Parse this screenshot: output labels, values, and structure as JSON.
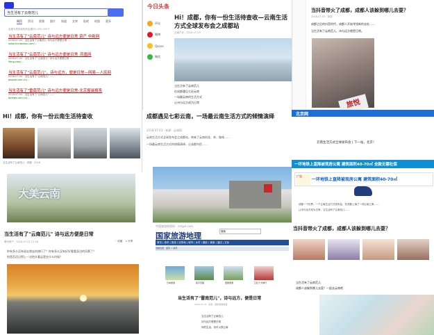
{
  "search": {
    "logo": "Bai",
    "query": "当生活有了云南范儿",
    "tabs": [
      "网页",
      "资讯",
      "视频",
      "图片",
      "知道",
      "文库",
      "贴吧",
      "地图",
      "更多"
    ],
    "count": "百度为您找到相关结果约1,030,000个",
    "results": [
      {
        "title": "当生活有了\"云南范儿\" 诗与远方便是日常 资产 中新网",
        "desc": "2018-07-02 · 当生活有了云南范儿 诗与远方便是日常 …",
        "url": "www.chinanews.com/..."
      },
      {
        "title": "当生活有了\"云南范儿\" 诗与远方便是日常_凤凰网",
        "desc": "2018-07-02 · 当生活有了\"云南范儿\" 诗与远方便是日常 …",
        "url": "ifeng.com/..."
      },
      {
        "title": "当生活有了\"云南范儿\"，诗与远方，便是日常—网易—人民网",
        "desc": "2018-07-02 · 当生活有了\"云南范儿\" ……",
        "url": "people.com.cn/..."
      },
      {
        "title": "当生活有了\"雷南范儿\" 诗与远方便是日常-北京屋晨报系",
        "desc": "2018-07-02 · 当生活有了\"云南范儿\" ……",
        "url": "bjnews.com.cn/..."
      }
    ]
  },
  "article_left": {
    "heading": "Hi！成都，你有一份云南生活待查收",
    "caption": "当生活有了云南范儿 · 成都 · 2018"
  },
  "toutiao": {
    "logo": "今日头条",
    "title": "Hi！成都，你有一份生活待查收—云南生活方式全球发布会之成都站",
    "meta": "云南产业 · 2018-07-03",
    "sidebar": [
      "评论",
      "微博",
      "Qzone",
      "微信"
    ],
    "body": [
      "当生活有了云南范儿",
      "在成都遇见七彩云南",
      "一场最云南的生活方式",
      "让诗与远方成为日常"
    ]
  },
  "yunnan": {
    "title": "成都遇见七彩云南，一场最云南生活方式的倾情演绎",
    "meta": "2018-07-03 · 来源：云南网",
    "lines": [
      "云南生活方式全球发布会之成都站，带来了云南的花、茶、咖啡……",
      "一场最云南生活方式的倾情演绎，让成都市民……"
    ]
  },
  "douyin": {
    "title": "当抖音带火了成都，成都人该躲到哪儿去耍？",
    "meta": "2018-07-03 · 阅读",
    "lines": [
      "成都之后的抖音时代，成都人开始寻找新的去处……",
      "当生活有了云南范儿，诗与远方便是日常。"
    ],
    "sign": "旅悦"
  },
  "news_mid": {
    "bar": "北京网",
    "title": "云南生活方式全球发布会 | 下一站，北京！",
    "banner": "一环地铁上直降被现房公寓 建筑面积40-70㎡ 全款无需社保"
  },
  "article_bottom": {
    "hero": "大美云南",
    "title": "当生活有了\"云南范儿\" 诗与远方便是日常",
    "meta": "腾讯房产 · 2018-07-02 11:26",
    "btn1": "♡ 收藏",
    "btn2": "< 分享",
    "lines": [
      "你有多久没有说走就走的旅行了？你有多久没有好好看看身边的风景了？",
      "你是否还记得上一次抬头看云是在什么时候？"
    ]
  },
  "tourism": {
    "top": "中国旅游地理网 · cntgol.com",
    "logo": "国家旅游地理",
    "search": "搜索",
    "nav": "首页 | 资讯 | 旅游 | 目的地 | 城市 | 乡村 | 摄影 | 美食 | 酒店 | 文化",
    "sub": "当前位置：首页 > 资讯",
    "thumbs": [
      "日本旅游",
      "和平天路",
      "西部旅游",
      "口红十大排行"
    ],
    "title": "当生活有了\"雷南范儿\"，诗与远方，便是日常",
    "meta": "2018-07-02 · 来源：国家旅游地理",
    "lines": [
      "当生活有了云南范儿",
      "诗与远方便是日常",
      "你的生活，也可以很云南"
    ]
  },
  "bottom_right": {
    "ad_tag": "广告",
    "ad": "一环地铁上直降被现房公寓 建筑面积40-70㎡",
    "lines": [
      "成都一个世界，一个云南生活方式发布会，在成都上演了一场云南之美……",
      "让诗与远方成为日常，当生活有了云南范儿……"
    ],
    "title": "当抖音带火了成都，成都人该躲到哪儿去耍？",
    "sub1": "当生活有了云南范儿",
    "sub2": "成都人该躲到哪儿去耍？一起去云南吧"
  }
}
